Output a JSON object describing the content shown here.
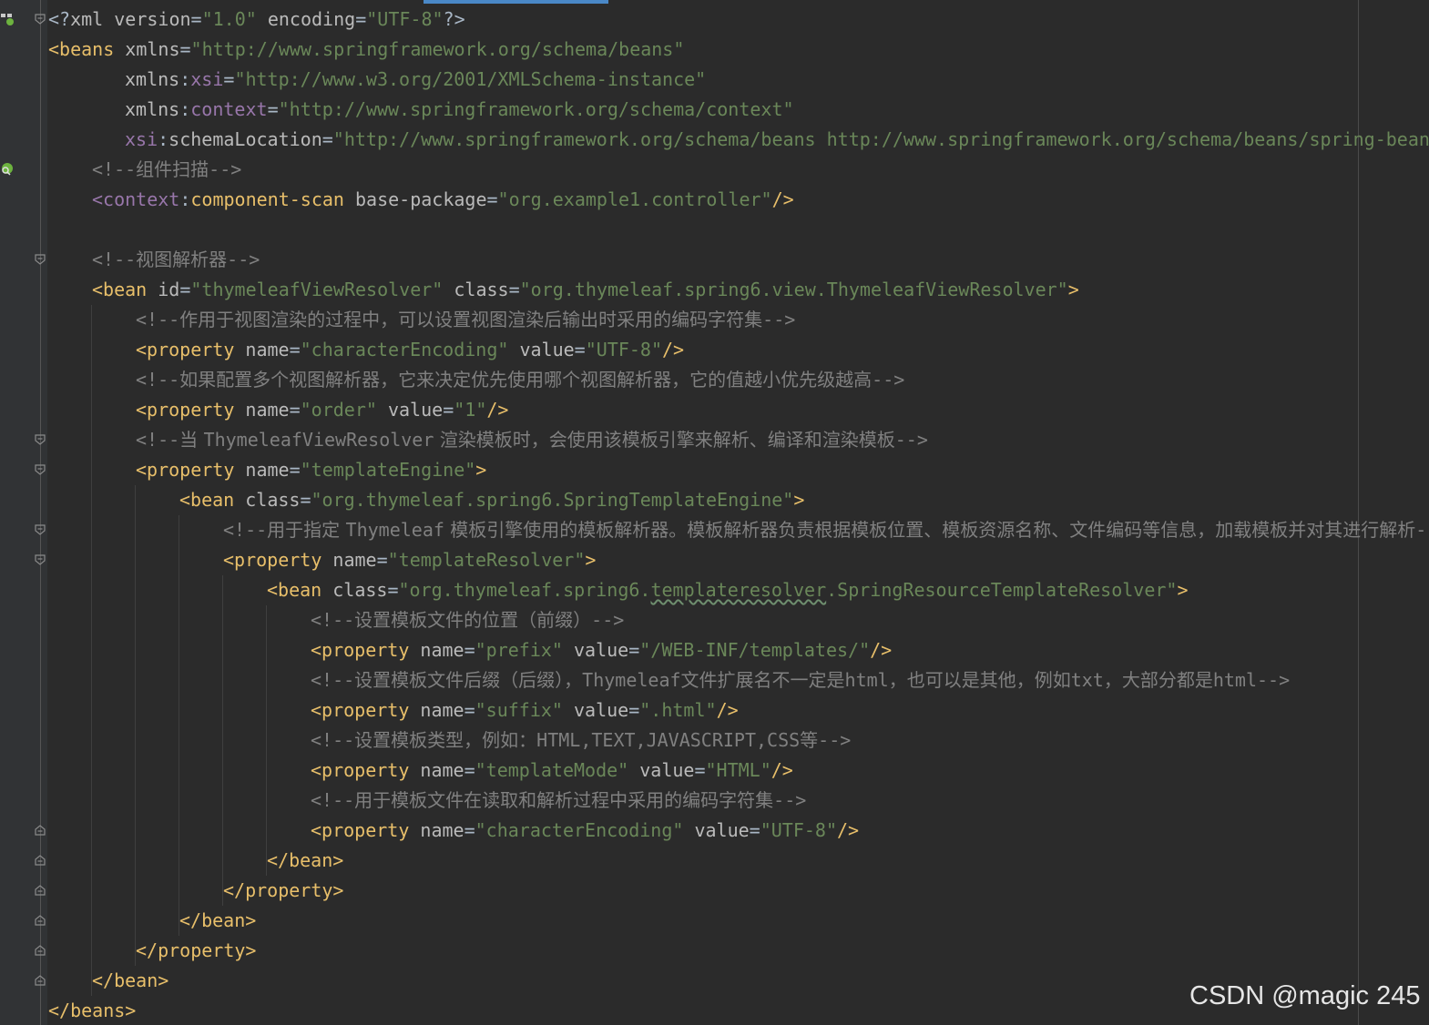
{
  "editor": {
    "language": "XML",
    "theme": {
      "background": "#2b2b2b",
      "tag": "#e8bf6a",
      "attribute": "#bababa",
      "namespace": "#9876aa",
      "string": "#6a8759",
      "comment": "#808080",
      "punct": "#a9b7c6"
    },
    "lines": [
      {
        "t": [
          [
            "p",
            "<?"
          ],
          [
            "attr",
            "xml version"
          ],
          [
            "p",
            "="
          ],
          [
            "val",
            "\"1.0\""
          ],
          [
            "attr",
            " encoding"
          ],
          [
            "p",
            "="
          ],
          [
            "val",
            "\"UTF-8\""
          ],
          [
            "p",
            "?>"
          ]
        ]
      },
      {
        "t": [
          [
            "tag",
            "<beans"
          ],
          [
            "attr",
            " xmlns"
          ],
          [
            "p",
            "="
          ],
          [
            "val",
            "\"http://www.springframework.org/schema/beans\""
          ]
        ]
      },
      {
        "t": [
          [
            "attr",
            "xmlns"
          ],
          [
            "p",
            ":"
          ],
          [
            "ns",
            "xsi"
          ],
          [
            "p",
            "="
          ],
          [
            "val",
            "\"http://www.w3.org/2001/XMLSchema-instance\""
          ]
        ]
      },
      {
        "t": [
          [
            "attr",
            "xmlns"
          ],
          [
            "p",
            ":"
          ],
          [
            "ns",
            "context"
          ],
          [
            "p",
            "="
          ],
          [
            "val",
            "\"http://www.springframework.org/schema/context\""
          ]
        ]
      },
      {
        "t": [
          [
            "ns",
            "xsi"
          ],
          [
            "p",
            ":"
          ],
          [
            "attr",
            "schemaLocation"
          ],
          [
            "p",
            "="
          ],
          [
            "val",
            "\"http://www.springframework.org/schema/beans http://www.springframework.org/schema/beans/spring-beans.xsd\""
          ]
        ]
      },
      {
        "t": [
          [
            "cmo",
            "<!--"
          ],
          [
            "cm",
            "组件扫描"
          ],
          [
            "cmo",
            "-->"
          ]
        ]
      },
      {
        "t": [
          [
            "ns",
            "<context"
          ],
          [
            "p",
            ":"
          ],
          [
            "tag",
            "component-scan"
          ],
          [
            "attr",
            " base-package"
          ],
          [
            "p",
            "="
          ],
          [
            "val",
            "\"org.example1.controller\""
          ],
          [
            "tag",
            "/>"
          ]
        ]
      },
      {
        "t": []
      },
      {
        "t": [
          [
            "cmo",
            "<!--"
          ],
          [
            "cm",
            "视图解析器"
          ],
          [
            "cmo",
            "-->"
          ]
        ]
      },
      {
        "t": [
          [
            "tag",
            "<bean"
          ],
          [
            "attr",
            " id"
          ],
          [
            "p",
            "="
          ],
          [
            "val",
            "\"thymeleafViewResolver\""
          ],
          [
            "attr",
            " class"
          ],
          [
            "p",
            "="
          ],
          [
            "val",
            "\"org.thymeleaf.spring6.view.ThymeleafViewResolver\""
          ],
          [
            "tag",
            ">"
          ]
        ]
      },
      {
        "t": [
          [
            "cmo",
            "<!--"
          ],
          [
            "cm",
            "作用于视图渲染的过程中，可以设置视图渲染后输出时采用的编码字符集"
          ],
          [
            "cmo",
            "-->"
          ]
        ]
      },
      {
        "t": [
          [
            "tag",
            "<property"
          ],
          [
            "attr",
            " name"
          ],
          [
            "p",
            "="
          ],
          [
            "val",
            "\"characterEncoding\""
          ],
          [
            "attr",
            " value"
          ],
          [
            "p",
            "="
          ],
          [
            "val",
            "\"UTF-8\""
          ],
          [
            "tag",
            "/>"
          ]
        ]
      },
      {
        "t": [
          [
            "cmo",
            "<!--"
          ],
          [
            "cm",
            "如果配置多个视图解析器，它来决定优先使用哪个视图解析器，它的值越小优先级越高"
          ],
          [
            "cmo",
            "-->"
          ]
        ]
      },
      {
        "t": [
          [
            "tag",
            "<property"
          ],
          [
            "attr",
            " name"
          ],
          [
            "p",
            "="
          ],
          [
            "val",
            "\"order\""
          ],
          [
            "attr",
            " value"
          ],
          [
            "p",
            "="
          ],
          [
            "val",
            "\"1\""
          ],
          [
            "tag",
            "/>"
          ]
        ]
      },
      {
        "t": [
          [
            "cmo",
            "<!--"
          ],
          [
            "cm",
            "当 "
          ],
          [
            "cmo",
            "ThymeleafViewResolver"
          ],
          [
            "cm",
            " 渲染模板时，会使用该模板引擎来解析、编译和渲染模板"
          ],
          [
            "cmo",
            "-->"
          ]
        ]
      },
      {
        "t": [
          [
            "tag",
            "<property"
          ],
          [
            "attr",
            " name"
          ],
          [
            "p",
            "="
          ],
          [
            "val",
            "\"templateEngine\""
          ],
          [
            "tag",
            ">"
          ]
        ]
      },
      {
        "t": [
          [
            "tag",
            "<bean"
          ],
          [
            "attr",
            " class"
          ],
          [
            "p",
            "="
          ],
          [
            "val",
            "\"org.thymeleaf.spring6.SpringTemplateEngine\""
          ],
          [
            "tag",
            ">"
          ]
        ]
      },
      {
        "t": [
          [
            "cmo",
            "<!--"
          ],
          [
            "cm",
            "用于指定 "
          ],
          [
            "cmo",
            "Thymeleaf"
          ],
          [
            "cm",
            " 模板引擎使用的模板解析器。模板解析器负责根据模板位置、模板资源名称、文件编码等信息，加载模板并对其进行解析"
          ],
          [
            "cmo",
            "-->"
          ]
        ]
      },
      {
        "t": [
          [
            "tag",
            "<property"
          ],
          [
            "attr",
            " name"
          ],
          [
            "p",
            "="
          ],
          [
            "val",
            "\"templateResolver\""
          ],
          [
            "tag",
            ">"
          ]
        ]
      },
      {
        "t": [
          [
            "tag",
            "<bean"
          ],
          [
            "attr",
            " class"
          ],
          [
            "p",
            "="
          ],
          [
            "val",
            "\"org.thymeleaf.spring6."
          ],
          [
            "val ul",
            "templateresolver"
          ],
          [
            "val",
            ".SpringResourceTemplateResolver\""
          ],
          [
            "tag",
            ">"
          ]
        ]
      },
      {
        "t": [
          [
            "cmo",
            "<!--"
          ],
          [
            "cm",
            "设置模板文件的位置（前缀）"
          ],
          [
            "cmo",
            "-->"
          ]
        ]
      },
      {
        "t": [
          [
            "tag",
            "<property"
          ],
          [
            "attr",
            " name"
          ],
          [
            "p",
            "="
          ],
          [
            "val",
            "\"prefix\""
          ],
          [
            "attr",
            " value"
          ],
          [
            "p",
            "="
          ],
          [
            "val",
            "\"/WEB-INF/templates/\""
          ],
          [
            "tag",
            "/>"
          ]
        ]
      },
      {
        "t": [
          [
            "cmo",
            "<!--"
          ],
          [
            "cm",
            "设置模板文件后缀（后缀），"
          ],
          [
            "cmo",
            "Thymeleaf"
          ],
          [
            "cm",
            "文件扩展名不一定是"
          ],
          [
            "cmo",
            "html"
          ],
          [
            "cm",
            "，也可以是其他，例如"
          ],
          [
            "cmo",
            "txt"
          ],
          [
            "cm",
            "，大部分都是"
          ],
          [
            "cmo",
            "html-->"
          ]
        ]
      },
      {
        "t": [
          [
            "tag",
            "<property"
          ],
          [
            "attr",
            " name"
          ],
          [
            "p",
            "="
          ],
          [
            "val",
            "\"suffix\""
          ],
          [
            "attr",
            " value"
          ],
          [
            "p",
            "="
          ],
          [
            "val",
            "\".html\""
          ],
          [
            "tag",
            "/>"
          ]
        ]
      },
      {
        "t": [
          [
            "cmo",
            "<!--"
          ],
          [
            "cm",
            "设置模板类型，例如："
          ],
          [
            "cmo",
            "HTML,TEXT,JAVASCRIPT,CSS"
          ],
          [
            "cm",
            "等"
          ],
          [
            "cmo",
            "-->"
          ]
        ]
      },
      {
        "t": [
          [
            "tag",
            "<property"
          ],
          [
            "attr",
            " name"
          ],
          [
            "p",
            "="
          ],
          [
            "val",
            "\"templateMode\""
          ],
          [
            "attr",
            " value"
          ],
          [
            "p",
            "="
          ],
          [
            "val",
            "\"HTML\""
          ],
          [
            "tag",
            "/>"
          ]
        ]
      },
      {
        "t": [
          [
            "cmo",
            "<!--"
          ],
          [
            "cm",
            "用于模板文件在读取和解析过程中采用的编码字符集"
          ],
          [
            "cmo",
            "-->"
          ]
        ]
      },
      {
        "t": [
          [
            "tag",
            "<property"
          ],
          [
            "attr",
            " name"
          ],
          [
            "p",
            "="
          ],
          [
            "val",
            "\"characterEncoding\""
          ],
          [
            "attr",
            " value"
          ],
          [
            "p",
            "="
          ],
          [
            "val",
            "\"UTF-8\""
          ],
          [
            "tag",
            "/>"
          ]
        ]
      },
      {
        "t": [
          [
            "tag",
            "</bean>"
          ]
        ]
      },
      {
        "t": [
          [
            "tag",
            "</property>"
          ]
        ]
      },
      {
        "t": [
          [
            "tag",
            "</bean>"
          ]
        ]
      },
      {
        "t": [
          [
            "tag",
            "</property>"
          ]
        ]
      },
      {
        "t": [
          [
            "tag",
            "</bean>"
          ]
        ]
      },
      {
        "t": [
          [
            "tag",
            "</beans>"
          ]
        ]
      }
    ]
  },
  "gutter_icons": [
    {
      "line": 1,
      "name": "spring-bean-gutter-icon"
    },
    {
      "line": 6,
      "name": "spring-search-gutter-icon"
    }
  ],
  "folds": [
    {
      "line": 1,
      "kind": "open"
    },
    {
      "line": 9,
      "kind": "open"
    },
    {
      "line": 15,
      "kind": "open"
    },
    {
      "line": 16,
      "kind": "open"
    },
    {
      "line": 18,
      "kind": "open"
    },
    {
      "line": 19,
      "kind": "open"
    },
    {
      "line": 28,
      "kind": "close"
    },
    {
      "line": 29,
      "kind": "close"
    },
    {
      "line": 30,
      "kind": "close"
    },
    {
      "line": 31,
      "kind": "close"
    },
    {
      "line": 32,
      "kind": "close"
    },
    {
      "line": 33,
      "kind": "close"
    }
  ],
  "watermark": "CSDN @magic 245"
}
